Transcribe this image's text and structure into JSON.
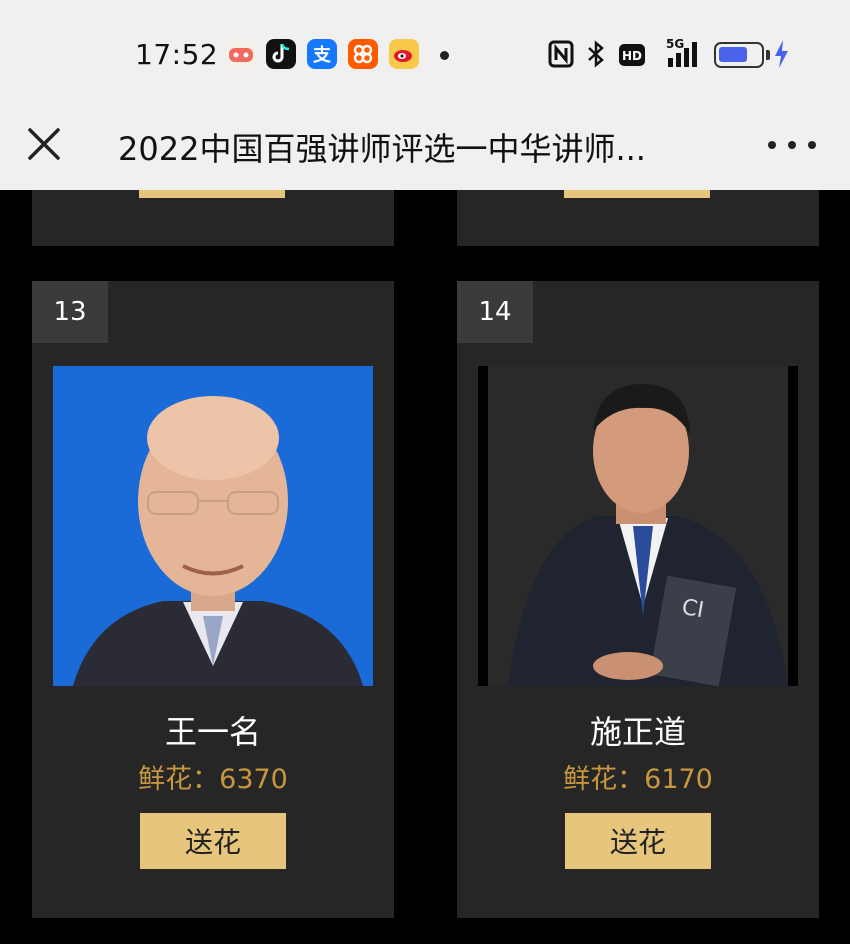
{
  "status_bar": {
    "time": "17:52",
    "apps": [
      {
        "icon": "game-app-icon",
        "color": "#f4f0e8",
        "glyph": "🎮"
      },
      {
        "icon": "douyin-icon",
        "color": "#111111",
        "glyph": "♪"
      },
      {
        "icon": "alipay-icon",
        "color": "#1677ff",
        "glyph": "支"
      },
      {
        "icon": "taobao-icon",
        "color": "#ff5a00",
        "glyph": "淘"
      },
      {
        "icon": "weibo-icon",
        "color": "#f7c948",
        "glyph": "微"
      }
    ],
    "nfc": "N",
    "bluetooth": "✱",
    "hd": "HD",
    "network": "5G"
  },
  "title_bar": {
    "title": "2022中国百强讲师评选一中华讲师..."
  },
  "colors": {
    "card_bg": "#262626",
    "accent_gold": "#e6c67c",
    "flower_text": "#c8963f"
  },
  "cards": [
    {
      "rank": "13",
      "name": "王一名",
      "flowers": "鲜花：6370",
      "button": "送花",
      "photo_bg": "#1a6ad8"
    },
    {
      "rank": "14",
      "name": "施正道",
      "flowers": "鲜花：6170",
      "button": "送花",
      "photo_bg": "#2a2a2a"
    }
  ]
}
